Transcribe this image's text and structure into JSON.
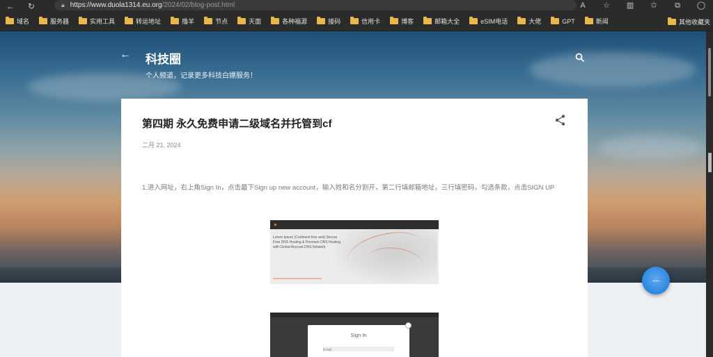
{
  "browser": {
    "url_host": "https://www.duola1314.eu.org",
    "url_path": "/2024/02/blog-post.html"
  },
  "bookmarks": [
    {
      "label": "域名",
      "icon": "folder-icon"
    },
    {
      "label": "服务器",
      "icon": "folder-icon"
    },
    {
      "label": "实用工具",
      "icon": "folder-icon"
    },
    {
      "label": "转运地址",
      "icon": "folder-icon"
    },
    {
      "label": "撸羊",
      "icon": "folder-icon"
    },
    {
      "label": "节点",
      "icon": "folder-icon"
    },
    {
      "label": "天面",
      "icon": "folder-icon"
    },
    {
      "label": "各种福源",
      "icon": "folder-icon"
    },
    {
      "label": "接码",
      "icon": "folder-icon"
    },
    {
      "label": "信用卡",
      "icon": "folder-icon"
    },
    {
      "label": "博客",
      "icon": "folder-icon"
    },
    {
      "label": "邮箱大全",
      "icon": "folder-icon"
    },
    {
      "label": "eSIM电话",
      "icon": "folder-icon"
    },
    {
      "label": "大佬",
      "icon": "folder-icon"
    },
    {
      "label": "GPT",
      "icon": "folder-icon"
    },
    {
      "label": "新闻",
      "icon": "folder-icon"
    }
  ],
  "other_bookmarks": "其他收藏夹",
  "blog": {
    "title": "科技圈",
    "description": "个人频道，记录更多科技白嫖服务！"
  },
  "post": {
    "title": "第四期 永久免费申请二级域名并托管到cf",
    "date": "二月 21, 2024",
    "paragraph": "1.进入网址，右上角Sign In，点击最下Sign up new account，输入姓和名分割开，第二行填邮箱地址，三行填密码，勾选条款，点击SIGN UP"
  },
  "screenshot1": {
    "text": "Lorem Ipsum (Continent free and) Secure Free DNS Hosting & Premium DNS Hosting with Global Anycast DNS Network"
  },
  "screenshot2": {
    "modal_title": "Sign In",
    "field_label": "Email"
  },
  "colors": {
    "accent": "#2b86e0",
    "folder": "#e8b84a",
    "toolbar": "#2b2b2b"
  }
}
